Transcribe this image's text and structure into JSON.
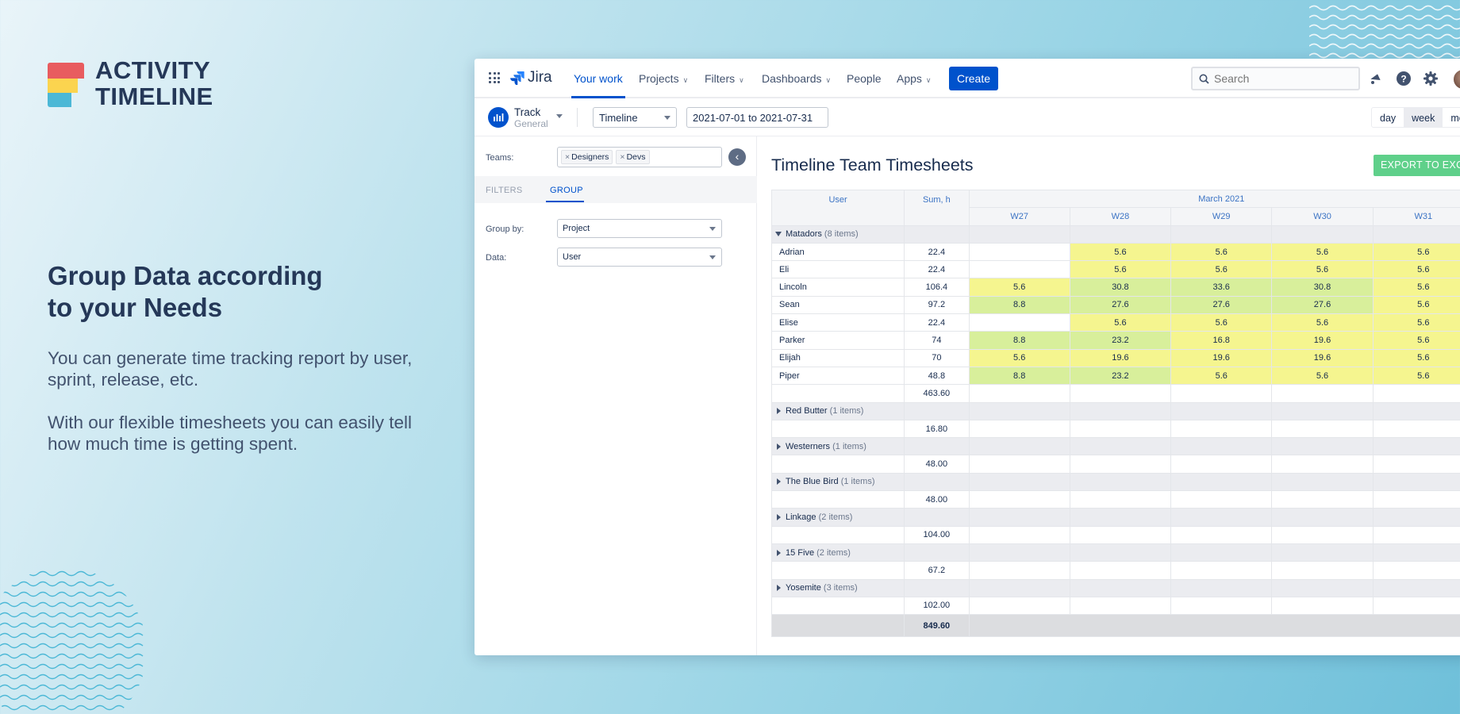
{
  "brand": {
    "line1": "ACTIVITY",
    "line2": "TIMELINE"
  },
  "hero": {
    "headline_l1": "Group Data according",
    "headline_l2": "to your Needs",
    "para1": "You can generate time tracking report by user, sprint, release, etc.",
    "para2": "With our flexible timesheets you can easily tell how much time is getting spent."
  },
  "nav": {
    "logo": "Jira",
    "your_work": "Your work",
    "projects": "Projects",
    "filters": "Filters",
    "dashboards": "Dashboards",
    "people": "People",
    "apps": "Apps",
    "create": "Create",
    "search_placeholder": "Search"
  },
  "subbar": {
    "track_title": "Track",
    "track_sub": "General",
    "view_select": "Timeline",
    "date_range": "2021-07-01 to 2021-07-31",
    "views": [
      "day",
      "week",
      "mon"
    ]
  },
  "left_panel": {
    "teams_label": "Teams:",
    "teams": [
      "Designers",
      "Devs"
    ],
    "tab_filters": "FILTERS",
    "tab_group": "GROUP",
    "group_by_label": "Group by:",
    "group_by_value": "Project",
    "data_label": "Data:",
    "data_value": "User"
  },
  "report": {
    "title": "Timeline Team Timesheets",
    "export": "EXPORT TO EXC",
    "col_user": "User",
    "col_sum": "Sum, h",
    "month": "March 2021",
    "weeks": [
      "W27",
      "W28",
      "W29",
      "W30",
      "W31"
    ],
    "groups": [
      {
        "name": "Matadors",
        "count": "(8 items)",
        "expanded": true,
        "rows": [
          {
            "user": "Adrian",
            "sum": "22.4",
            "cells": [
              [
                "",
                ""
              ],
              [
                "5.6",
                "y"
              ],
              [
                "5.6",
                "y"
              ],
              [
                "5.6",
                "y"
              ],
              [
                "5.6",
                "y"
              ]
            ]
          },
          {
            "user": "Eli",
            "sum": "22.4",
            "cells": [
              [
                "",
                ""
              ],
              [
                "5.6",
                "y"
              ],
              [
                "5.6",
                "y"
              ],
              [
                "5.6",
                "y"
              ],
              [
                "5.6",
                "y"
              ]
            ]
          },
          {
            "user": "Lincoln",
            "sum": "106.4",
            "cells": [
              [
                "5.6",
                "y"
              ],
              [
                "30.8",
                "g"
              ],
              [
                "33.6",
                "g"
              ],
              [
                "30.8",
                "g"
              ],
              [
                "5.6",
                "y"
              ]
            ]
          },
          {
            "user": "Sean",
            "sum": "97.2",
            "cells": [
              [
                "8.8",
                "g"
              ],
              [
                "27.6",
                "g"
              ],
              [
                "27.6",
                "g"
              ],
              [
                "27.6",
                "g"
              ],
              [
                "5.6",
                "y"
              ]
            ]
          },
          {
            "user": "Elise",
            "sum": "22.4",
            "cells": [
              [
                "",
                ""
              ],
              [
                "5.6",
                "y"
              ],
              [
                "5.6",
                "y"
              ],
              [
                "5.6",
                "y"
              ],
              [
                "5.6",
                "y"
              ]
            ]
          },
          {
            "user": "Parker",
            "sum": "74",
            "cells": [
              [
                "8.8",
                "g"
              ],
              [
                "23.2",
                "g"
              ],
              [
                "16.8",
                "y"
              ],
              [
                "19.6",
                "y"
              ],
              [
                "5.6",
                "y"
              ]
            ]
          },
          {
            "user": "Elijah",
            "sum": "70",
            "cells": [
              [
                "5.6",
                "y"
              ],
              [
                "19.6",
                "y"
              ],
              [
                "19.6",
                "y"
              ],
              [
                "19.6",
                "y"
              ],
              [
                "5.6",
                "y"
              ]
            ]
          },
          {
            "user": "Piper",
            "sum": "48.8",
            "cells": [
              [
                "8.8",
                "g"
              ],
              [
                "23.2",
                "g"
              ],
              [
                "5.6",
                "y"
              ],
              [
                "5.6",
                "y"
              ],
              [
                "5.6",
                "y"
              ]
            ]
          }
        ],
        "subtotal": "463.60"
      },
      {
        "name": "Red Butter",
        "count": "(1 items)",
        "expanded": false,
        "rows": [],
        "subtotal": "16.80"
      },
      {
        "name": "Westerners",
        "count": "(1 items)",
        "expanded": false,
        "rows": [],
        "subtotal": "48.00"
      },
      {
        "name": "The Blue Bird",
        "count": "(1 items)",
        "expanded": false,
        "rows": [],
        "subtotal": "48.00"
      },
      {
        "name": "Linkage",
        "count": "(2 items)",
        "expanded": false,
        "rows": [],
        "subtotal": "104.00"
      },
      {
        "name": "15 Five",
        "count": "(2 items)",
        "expanded": false,
        "rows": [],
        "subtotal": "67.2"
      },
      {
        "name": "Yosemite",
        "count": "(3 items)",
        "expanded": false,
        "rows": [],
        "subtotal": "102.00"
      }
    ],
    "grand_total": "849.60"
  },
  "colors": {
    "accent": "#0052cc",
    "export": "#5fd08a",
    "cell_yellow": "#f5f58f",
    "cell_green": "#d8ef9b"
  }
}
